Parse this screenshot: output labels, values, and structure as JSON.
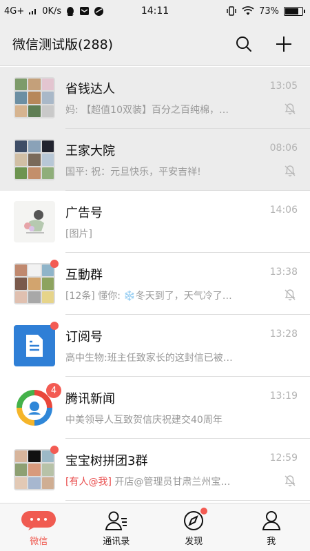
{
  "status_bar": {
    "network": "4G+",
    "speed": "0K/s",
    "time": "14:11",
    "battery": "73%",
    "battery_level": 0.73
  },
  "header": {
    "title": "微信测试版(288)",
    "search_icon": "search-icon",
    "add_icon": "plus-icon"
  },
  "chats": [
    {
      "name": "省钱达人",
      "time": "13:05",
      "preview": "妈: 【超值10双装】百分之百纯棉，…",
      "muted": true,
      "pinned": true
    },
    {
      "name": "王家大院",
      "time": "08:06",
      "preview": "国平: 祝：元旦快乐，平安吉祥!",
      "muted": true,
      "pinned": true
    },
    {
      "name": "广告号",
      "time": "14:06",
      "preview": "[图片]",
      "muted": false,
      "pinned": false
    },
    {
      "name": "互動群",
      "time": "13:38",
      "preview": "[12条] 懂你: ❄️冬天到了，天气冷了…",
      "muted": true,
      "pinned": false,
      "dot": true
    },
    {
      "name": "订阅号",
      "time": "13:28",
      "preview": "高中生物:班主任致家长的这封信已被…",
      "muted": false,
      "pinned": false,
      "dot": true
    },
    {
      "name": "腾讯新闻",
      "time": "13:19",
      "preview": "中美领导人互致贺信庆祝建交40周年",
      "muted": false,
      "pinned": false,
      "badge": "4"
    },
    {
      "name": "宝宝树拼团3群",
      "time": "12:59",
      "mention": "[有人@我]",
      "preview": " 开店@管理员甘肃兰州宝…",
      "muted": true,
      "pinned": false,
      "dot": true
    }
  ],
  "tabs": [
    {
      "label": "微信",
      "active": true
    },
    {
      "label": "通讯录",
      "active": false
    },
    {
      "label": "发现",
      "active": false,
      "dot": true
    },
    {
      "label": "我",
      "active": false
    }
  ],
  "colors": {
    "accent": "#f05b51",
    "badge": "#f35b53",
    "header_bg": "#eeeeee",
    "pinned_bg": "#ececec",
    "subscription_blue": "#2f7fd6"
  }
}
